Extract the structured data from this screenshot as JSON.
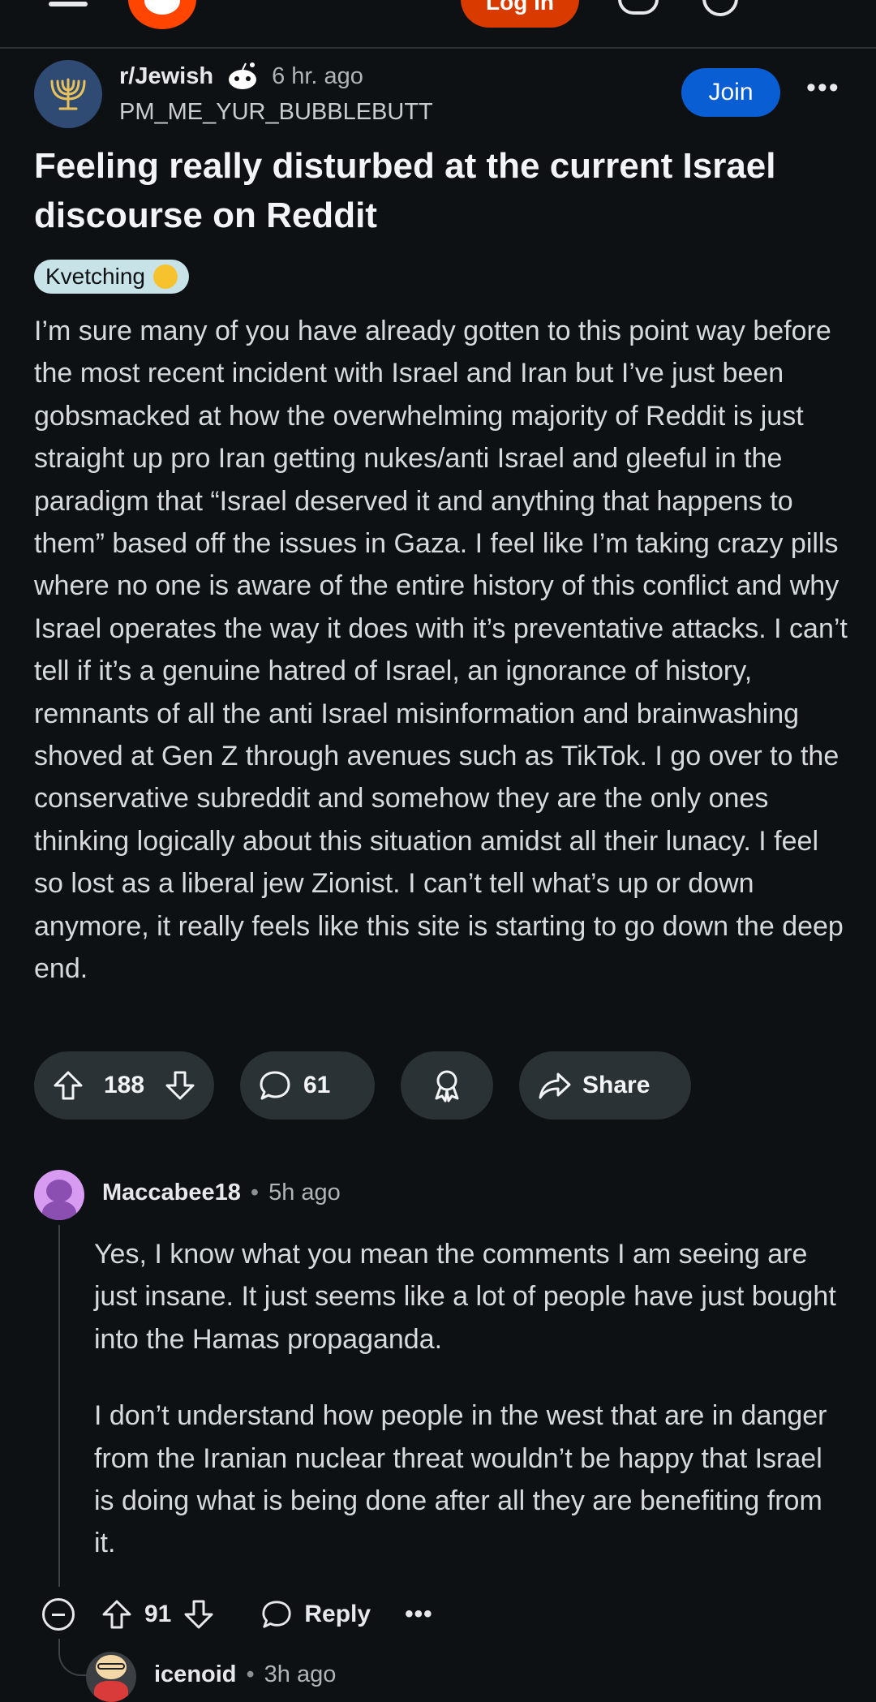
{
  "header": {
    "login_label": "Log In"
  },
  "post": {
    "subreddit": "r/Jewish",
    "time": "6 hr. ago",
    "author": "PM_ME_YUR_BUBBLEBUTT",
    "join_label": "Join",
    "more_label": "•••",
    "title": "Feeling really disturbed at the current Israel discourse on Reddit",
    "flair": "Kvetching",
    "body": "I’m sure many of you have already gotten to this point way before the most recent incident with Israel and Iran but I’ve just been gobsmacked at how the overwhelming majority of Reddit is just straight up pro Iran getting nukes/anti Israel and gleeful in the paradigm that “Israel deserved it and anything that happens to them” based off the issues in Gaza. I feel like I’m taking crazy pills where no one is aware of the entire history of this conflict and why Israel operates the way it does with it’s preventative attacks. I can’t tell if it’s a genuine hatred of Israel, an ignorance of history, remnants of all the anti Israel misinformation and brainwashing shoved at Gen Z through avenues such as TikTok. I go over to the conservative subreddit and somehow they are the only ones thinking logically about this situation amidst all their lunacy. I feel so lost as a liberal jew Zionist. I can’t tell what’s up or down anymore, it really feels like this site is starting to go down the deep end.",
    "votes": "188",
    "comments": "61",
    "share_label": "Share"
  },
  "comments": [
    {
      "user": "Maccabee18",
      "time": "5h ago",
      "paragraphs": [
        "Yes, I know what you mean the comments I am seeing are just insane. It just seems like a lot of people have just bought into the Hamas propaganda.",
        "I don’t understand how people in the west that are in danger from the Iranian nuclear threat wouldn’t be happy that Israel is doing what is being done after all they are benefiting from it."
      ],
      "votes": "91",
      "reply_label": "Reply",
      "more_label": "•••"
    },
    {
      "user": "icenoid",
      "time": "3h ago"
    }
  ],
  "colors": {
    "background": "#0e1113",
    "accent_join": "#0a5ed3",
    "login": "#d93a00",
    "pill": "#2a3236",
    "flair": "#c7e3e8"
  }
}
